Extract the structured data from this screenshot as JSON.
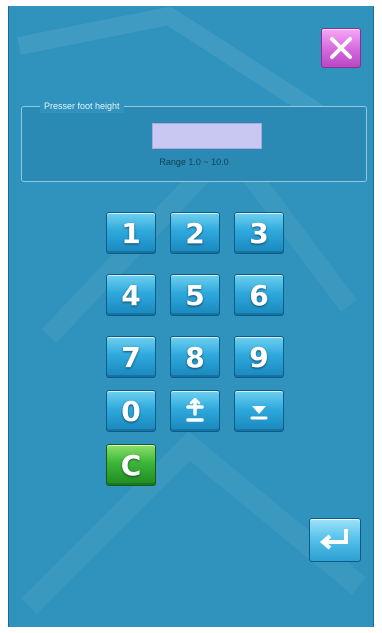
{
  "dialog": {
    "title": "Presser foot height",
    "value": "",
    "range": "Range 1.0 ~ 10.0",
    "value_color": "#c9c8f2",
    "background_color": "#2f93bd"
  },
  "close_button": {
    "icon": "close-icon",
    "color": "#d567de"
  },
  "keypad": {
    "keys": [
      {
        "label": "1",
        "name": "key-1"
      },
      {
        "label": "2",
        "name": "key-2"
      },
      {
        "label": "3",
        "name": "key-3"
      },
      {
        "label": "4",
        "name": "key-4"
      },
      {
        "label": "5",
        "name": "key-5"
      },
      {
        "label": "6",
        "name": "key-6"
      },
      {
        "label": "7",
        "name": "key-7"
      },
      {
        "label": "8",
        "name": "key-8"
      },
      {
        "label": "9",
        "name": "key-9"
      },
      {
        "label": "0",
        "name": "key-0"
      }
    ],
    "plus_minus_icon": "plus-minus-icon",
    "move_down_icon": "move-down-icon",
    "clear_label": "C",
    "key_color": "#2ea9dd",
    "clear_color": "#3db53a"
  },
  "enter_button": {
    "icon": "enter-icon"
  }
}
